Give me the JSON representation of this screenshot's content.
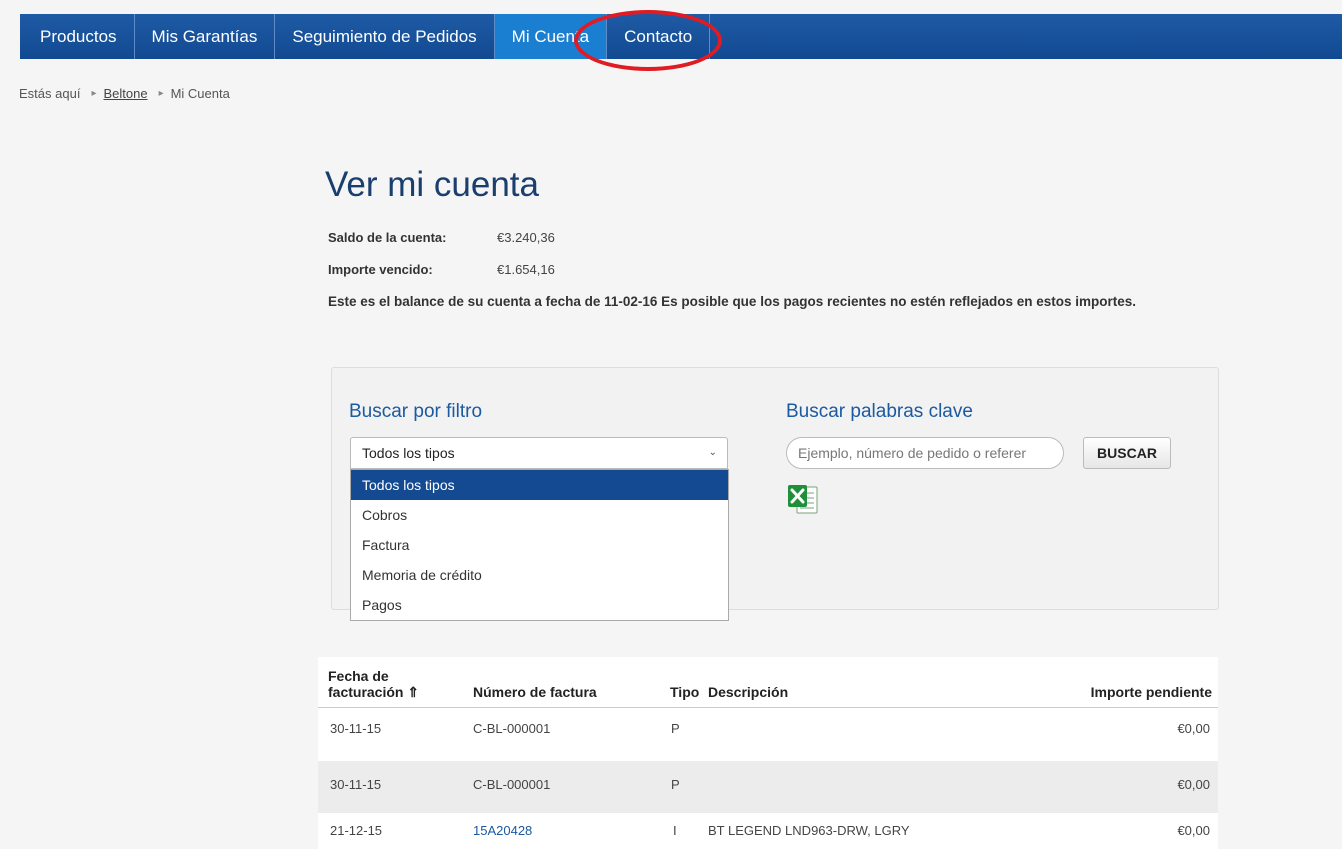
{
  "nav": {
    "items": [
      {
        "label": "Productos"
      },
      {
        "label": "Mis Garantías"
      },
      {
        "label": "Seguimiento de Pedidos"
      },
      {
        "label": "Mi Cuenta"
      },
      {
        "label": "Contacto"
      }
    ],
    "active": "Mi Cuenta"
  },
  "breadcrumb": {
    "prefix": "Estás aquí",
    "items": [
      "Beltone",
      "Mi Cuenta"
    ],
    "separator_icon": "chevron-right-icon"
  },
  "page": {
    "title": "Ver mi cuenta",
    "balance_label": "Saldo de la cuenta:",
    "balance_value": "€3.240,36",
    "overdue_label": "Importe vencido:",
    "overdue_value": "€1.654,16",
    "note": "Este es el balance de su cuenta a fecha de 11-02-16 Es posible que los pagos recientes no estén reflejados en estos importes."
  },
  "filter": {
    "heading": "Buscar por filtro",
    "selected": "Todos los tipos",
    "options": [
      "Todos los tipos",
      "Cobros",
      "Factura",
      "Memoria de crédito",
      "Pagos"
    ]
  },
  "keyword_search": {
    "heading": "Buscar palabras clave",
    "placeholder": "Ejemplo, número de pedido o referer",
    "button_label": "BUSCAR",
    "export_icon": "excel-icon"
  },
  "table": {
    "headers": {
      "date_line1": "Fecha de",
      "date_line2": "facturación ⇑",
      "invoice": "Número de factura",
      "type": "Tipo",
      "description": "Descripción",
      "amount": "Importe pendiente"
    },
    "rows": [
      {
        "date": "30-11-15",
        "invoice": "C-BL-000001",
        "type": "P",
        "description": "",
        "amount": "€0,00"
      },
      {
        "date": "30-11-15",
        "invoice": "C-BL-000001",
        "type": "P",
        "description": "",
        "amount": "€0,00"
      },
      {
        "date": "21-12-15",
        "invoice": "15A20428",
        "type": "I",
        "description": "BT LEGEND LND963-DRW, LGRY",
        "amount": "€0,00"
      }
    ]
  },
  "colors": {
    "nav_bg": "#114a91",
    "nav_active": "#1a7fd0",
    "highlight": "#e01b24",
    "title": "#1a3e6e",
    "link": "#1b5aa0"
  }
}
